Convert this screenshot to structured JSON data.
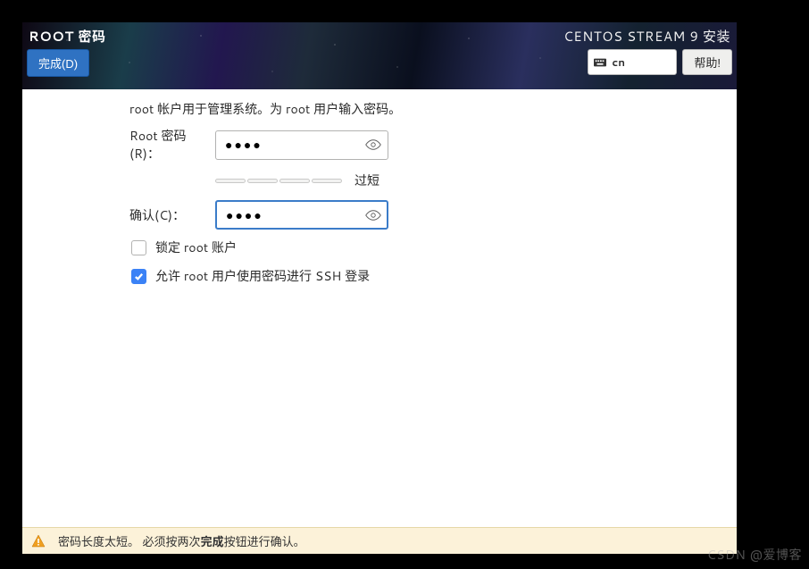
{
  "header": {
    "page_title": "ROOT 密码",
    "done_button": "完成(D)",
    "installer_title": "CENTOS STREAM 9 安装",
    "keyboard_layout": "cn",
    "help_button": "帮助!"
  },
  "form": {
    "description": "root 帐户用于管理系统。为 root 用户输入密码。",
    "password_label": "Root 密码(R)：",
    "password_value": "●●●●",
    "confirm_label": "确认(C)：",
    "confirm_value": "●●●●",
    "strength_text": "过短",
    "checkbox_lock_label": "锁定 root 账户",
    "checkbox_lock_checked": false,
    "checkbox_ssh_label": "允许 root 用户使用密码进行 SSH 登录",
    "checkbox_ssh_checked": true
  },
  "footer": {
    "message_prefix": "密码长度太短。 必须按两次",
    "message_bold": "完成",
    "message_suffix": "按钮进行确认。"
  },
  "watermark": "CSDN @爱博客"
}
